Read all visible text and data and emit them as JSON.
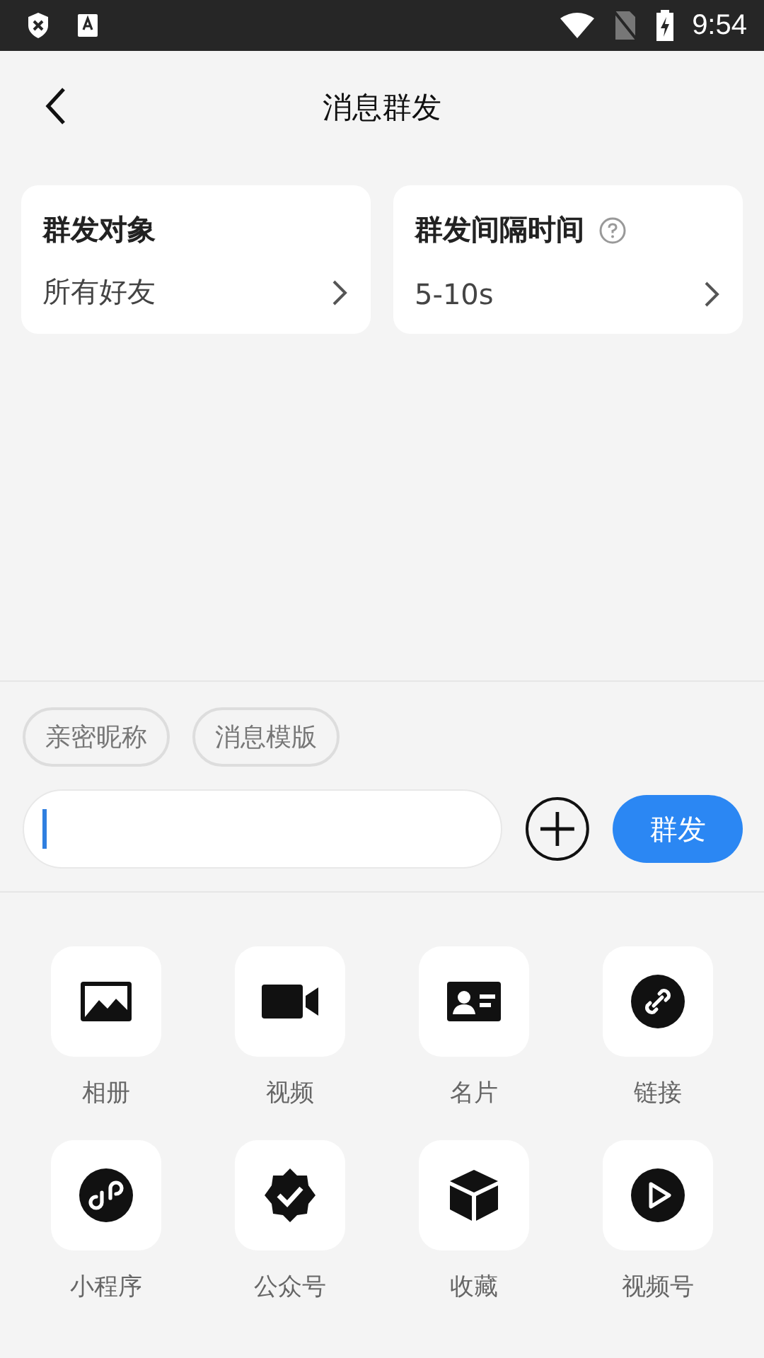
{
  "status_bar": {
    "time": "9:54"
  },
  "header": {
    "title": "消息群发"
  },
  "settings": [
    {
      "title": "群发对象",
      "value": "所有好友",
      "help": false
    },
    {
      "title": "群发间隔时间",
      "value": "5-10s",
      "help": true
    }
  ],
  "chips": [
    "亲密昵称",
    "消息模版"
  ],
  "composer": {
    "focused": true,
    "send": "群发"
  },
  "actions": [
    {
      "label": "相册"
    },
    {
      "label": "视频"
    },
    {
      "label": "名片"
    },
    {
      "label": "链接"
    },
    {
      "label": "小程序"
    },
    {
      "label": "公众号"
    },
    {
      "label": "收藏"
    },
    {
      "label": "视频号"
    }
  ]
}
